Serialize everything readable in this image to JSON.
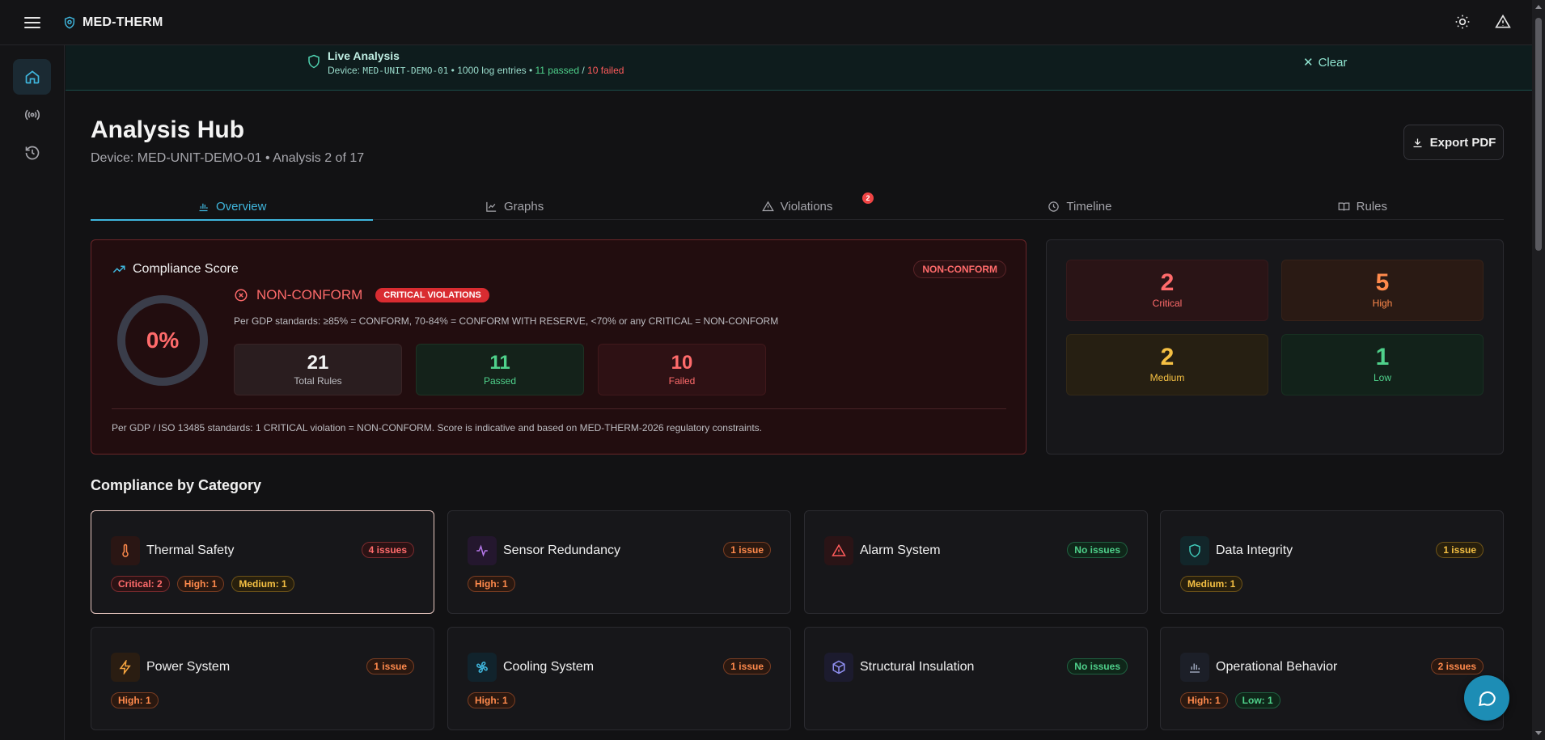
{
  "app": {
    "brand": "MED-THERM"
  },
  "live": {
    "title": "Live Analysis",
    "device_prefix": "Device:",
    "device_id": "MED-UNIT-DEMO-01",
    "sep1": "•",
    "entries": "1000 log entries",
    "sep2": "•",
    "passed": "11 passed",
    "slash": "/",
    "failed": "10 failed",
    "clear_label": "Clear"
  },
  "header": {
    "title": "Analysis Hub",
    "subtitle": "Device: MED-UNIT-DEMO-01 • Analysis 2 of 17",
    "export_label": "Export PDF"
  },
  "tabs": [
    {
      "label": "Overview",
      "icon": "bar-chart-icon",
      "active": true
    },
    {
      "label": "Graphs",
      "icon": "line-chart-icon"
    },
    {
      "label": "Violations",
      "icon": "warning-icon",
      "badge": "2"
    },
    {
      "label": "Timeline",
      "icon": "clock-icon"
    },
    {
      "label": "Rules",
      "icon": "book-icon"
    }
  ],
  "score": {
    "title": "Compliance Score",
    "pill": "NON-CONFORM",
    "value_text": "0%",
    "value": 0,
    "status": "NON-CONFORM",
    "tag": "CRITICAL VIOLATIONS",
    "standard_note": "Per GDP standards: ≥85% = CONFORM, 70-84% = CONFORM WITH RESERVE, <70% or any CRITICAL = NON-CONFORM",
    "stats": [
      {
        "num": "21",
        "label": "Total Rules"
      },
      {
        "num": "11",
        "label": "Passed"
      },
      {
        "num": "10",
        "label": "Failed"
      }
    ],
    "footnote": "Per GDP / ISO 13485 standards: 1 CRITICAL violation = NON-CONFORM. Score is indicative and based on MED-THERM-2026 regulatory constraints."
  },
  "severity": [
    {
      "num": "2",
      "label": "Critical"
    },
    {
      "num": "5",
      "label": "High"
    },
    {
      "num": "2",
      "label": "Medium"
    },
    {
      "num": "1",
      "label": "Low"
    }
  ],
  "categories_title": "Compliance by Category",
  "categories": [
    {
      "name": "Thermal Safety",
      "issues": "4 issues",
      "icon": "thermometer-icon",
      "tags": [
        "Critical: 2",
        "High: 1",
        "Medium: 1"
      ]
    },
    {
      "name": "Sensor Redundancy",
      "issues": "1 issue",
      "icon": "activity-icon",
      "tags": [
        "High: 1"
      ]
    },
    {
      "name": "Alarm System",
      "issues": "No issues",
      "icon": "alert-triangle-icon",
      "tags": []
    },
    {
      "name": "Data Integrity",
      "issues": "1 issue",
      "icon": "shield-icon",
      "tags": [
        "Medium: 1"
      ]
    },
    {
      "name": "Power System",
      "issues": "1 issue",
      "icon": "lightning-icon",
      "tags": [
        "High: 1"
      ]
    },
    {
      "name": "Cooling System",
      "issues": "1 issue",
      "icon": "fan-icon",
      "tags": [
        "High: 1"
      ]
    },
    {
      "name": "Structural Insulation",
      "issues": "No issues",
      "icon": "box-icon",
      "tags": []
    },
    {
      "name": "Operational Behavior",
      "issues": "2 issues",
      "icon": "bar-chart-icon",
      "tags": [
        "High: 1",
        "Low: 1"
      ]
    }
  ],
  "colors": {
    "accent": "#3fb6dd",
    "critical": "#ff6b6b",
    "high": "#ff8a4c",
    "medium": "#f5c043",
    "low": "#4fd18b"
  }
}
